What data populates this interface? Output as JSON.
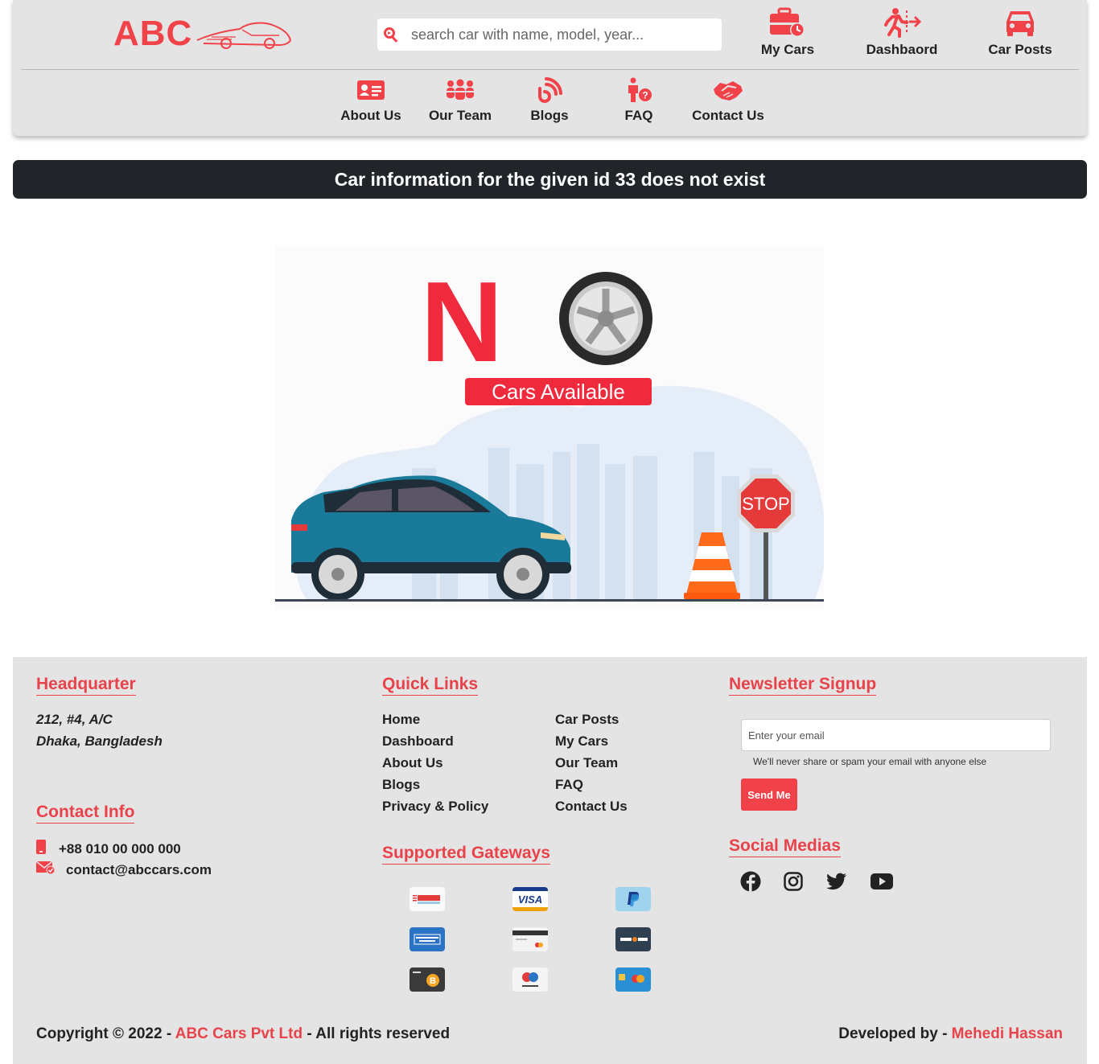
{
  "header": {
    "logo_text": "ABC",
    "search_placeholder": "search car with name, model, year...",
    "top_nav": [
      {
        "label": "My Cars",
        "icon": "briefcase-clock-icon"
      },
      {
        "label": "Dashbaord",
        "icon": "person-exit-icon"
      },
      {
        "label": "Car Posts",
        "icon": "car-icon"
      }
    ],
    "sub_nav": [
      {
        "label": "About Us",
        "icon": "id-card-icon"
      },
      {
        "label": "Our Team",
        "icon": "team-icon"
      },
      {
        "label": "Blogs",
        "icon": "blog-icon"
      },
      {
        "label": "FAQ",
        "icon": "person-question-icon"
      },
      {
        "label": "Contact Us",
        "icon": "handshake-icon"
      }
    ]
  },
  "alert": {
    "message": "Car information for the given id 33 does not exist"
  },
  "illustration": {
    "big_letter": "N",
    "banner": "Cars Available",
    "sign": "STOP"
  },
  "footer": {
    "headquarter": {
      "heading": "Headquarter",
      "line1": "212, #4, A/C",
      "line2": "Dhaka, Bangladesh"
    },
    "contact": {
      "heading": "Contact Info",
      "phone": "+88 010 00 000 000",
      "email": "contact@abccars.com"
    },
    "quick_links": {
      "heading": "Quick Links",
      "col1": [
        "Home",
        "Dashboard",
        "About Us",
        "Blogs",
        "Privacy & Policy"
      ],
      "col2": [
        "Car Posts",
        "My Cars",
        "Our Team",
        "FAQ",
        "Contact Us"
      ]
    },
    "gateways": {
      "heading": "Supported Gateways",
      "items": [
        "bank-transfer",
        "visa",
        "paypal",
        "american-express",
        "credit-card",
        "discover",
        "bitcoin",
        "maestro",
        "mastercard"
      ]
    },
    "newsletter": {
      "heading": "Newsletter Signup",
      "placeholder": "Enter your email",
      "hint": "We'll never share or spam your email with anyone else",
      "button": "Send Me"
    },
    "social": {
      "heading": "Social Medias",
      "items": [
        "facebook-icon",
        "instagram-icon",
        "twitter-icon",
        "youtube-icon"
      ]
    },
    "copyright": {
      "prefix": "Copyright © 2022 - ",
      "company": "ABC Cars Pvt Ltd",
      "suffix": " - All rights reserved"
    },
    "credit": {
      "prefix": "Developed by - ",
      "name": "Mehedi Hassan"
    }
  },
  "colors": {
    "accent": "#f1424a",
    "dark_bar": "#212529",
    "header_bg": "#e4e4e4"
  }
}
